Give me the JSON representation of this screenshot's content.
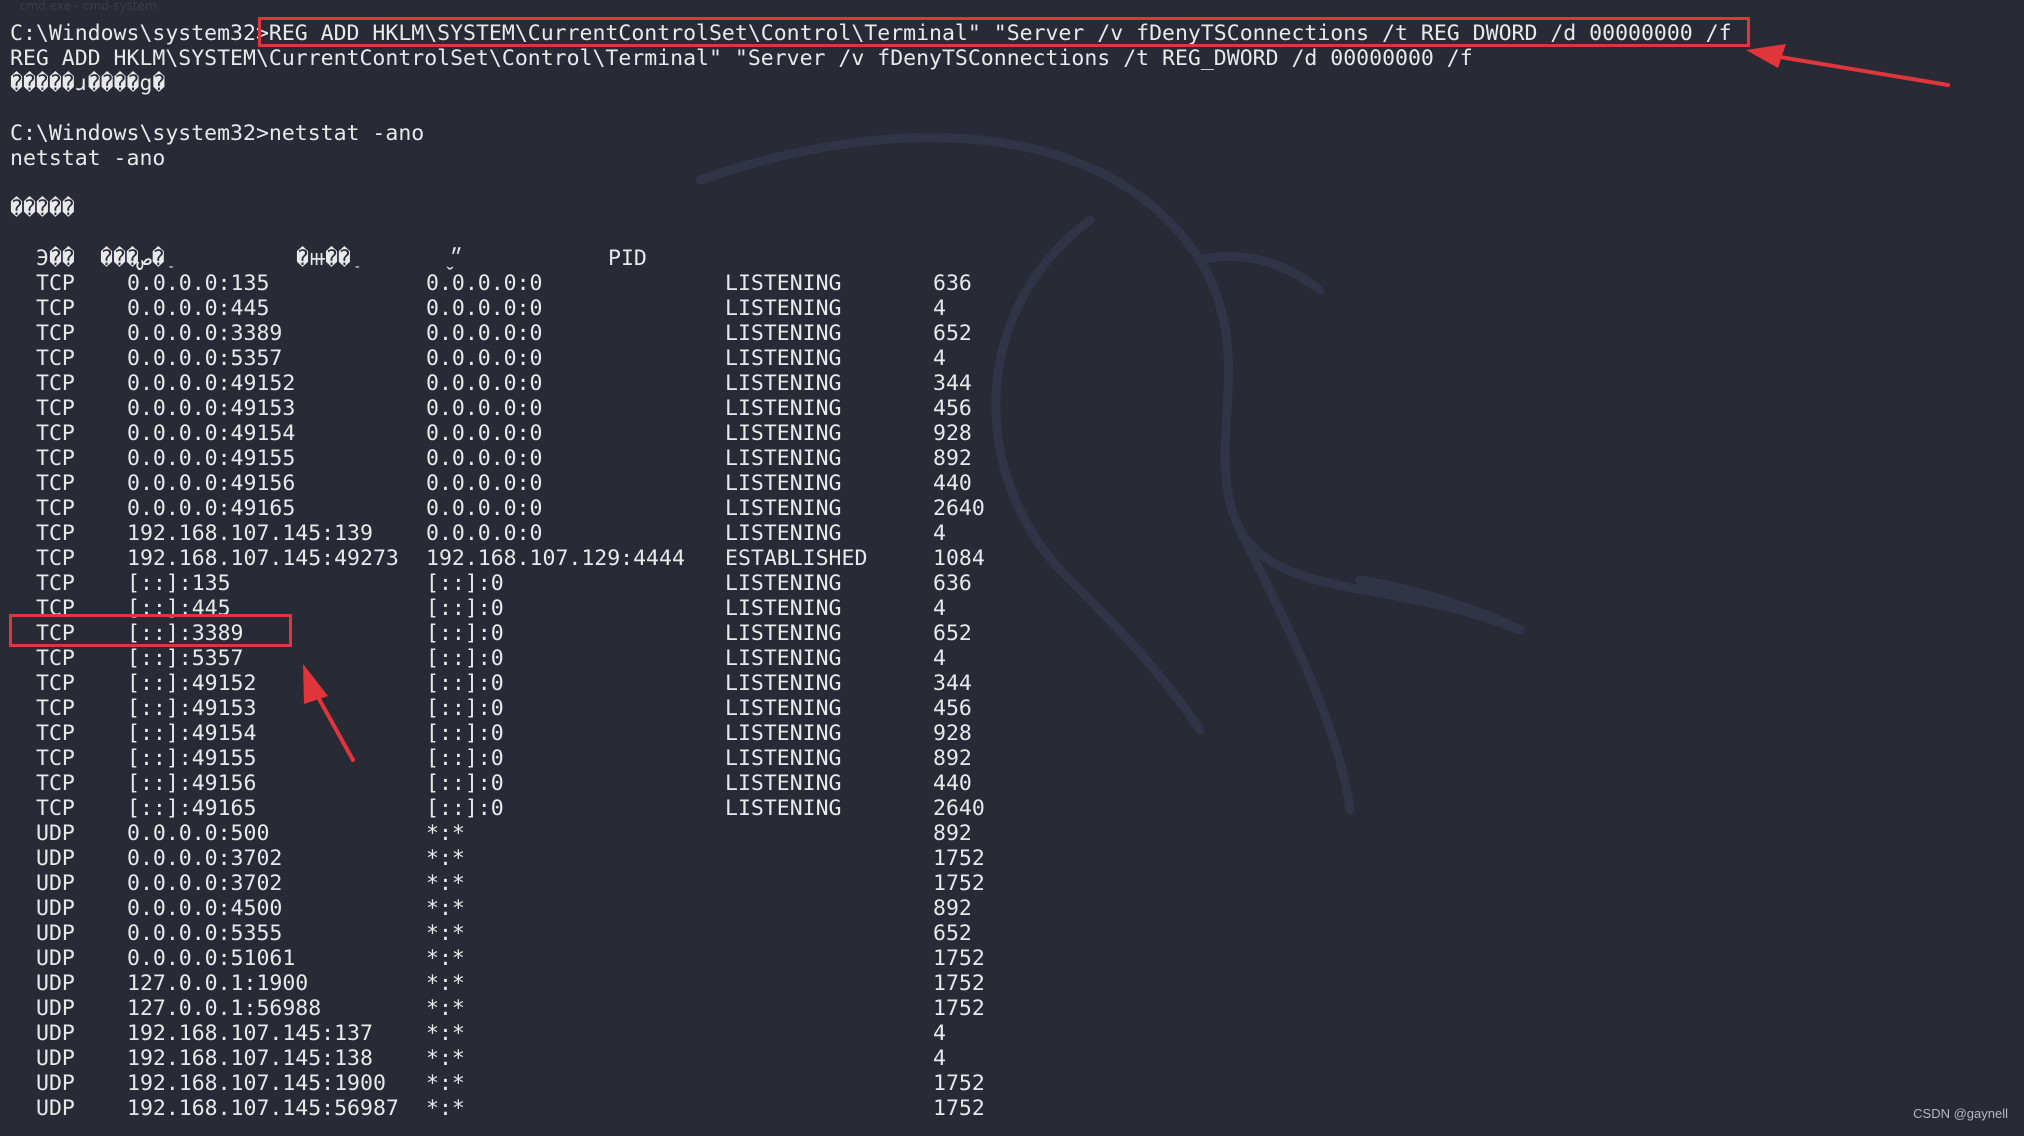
{
  "faint_header": "cmd.exe - cmd-system",
  "credit": "CSDN @gaynell",
  "colors": {
    "background": "#282a36",
    "text": "#e9e9ec",
    "highlight": "#e0353b"
  },
  "lines": [
    {
      "text": "C:\\Windows\\system32>REG ADD HKLM\\SYSTEM\\CurrentControlSet\\Control\\Terminal\" \"Server /v fDenyTSConnections /t REG_DWORD /d 00000000 /f"
    },
    {
      "text": "REG ADD HKLM\\SYSTEM\\CurrentControlSet\\Control\\Terminal\" \"Server /v fDenyTSConnections /t REG_DWORD /d 00000000 /f"
    },
    {
      "text": "�����ɹ����g�"
    },
    {
      "text": ""
    },
    {
      "text": "C:\\Windows\\system32>netstat -ano"
    },
    {
      "text": "netstat -ano"
    },
    {
      "text": ""
    },
    {
      "text": "�����"
    }
  ],
  "netstat": {
    "headers": [
      "Э��",
      "���ص�ַ",
      "�ⲿ��ַ",
      "״̬",
      "PID"
    ],
    "rows": [
      [
        "TCP",
        "0.0.0.0:135",
        "0.0.0.0:0",
        "LISTENING",
        "636"
      ],
      [
        "TCP",
        "0.0.0.0:445",
        "0.0.0.0:0",
        "LISTENING",
        "4"
      ],
      [
        "TCP",
        "0.0.0.0:3389",
        "0.0.0.0:0",
        "LISTENING",
        "652"
      ],
      [
        "TCP",
        "0.0.0.0:5357",
        "0.0.0.0:0",
        "LISTENING",
        "4"
      ],
      [
        "TCP",
        "0.0.0.0:49152",
        "0.0.0.0:0",
        "LISTENING",
        "344"
      ],
      [
        "TCP",
        "0.0.0.0:49153",
        "0.0.0.0:0",
        "LISTENING",
        "456"
      ],
      [
        "TCP",
        "0.0.0.0:49154",
        "0.0.0.0:0",
        "LISTENING",
        "928"
      ],
      [
        "TCP",
        "0.0.0.0:49155",
        "0.0.0.0:0",
        "LISTENING",
        "892"
      ],
      [
        "TCP",
        "0.0.0.0:49156",
        "0.0.0.0:0",
        "LISTENING",
        "440"
      ],
      [
        "TCP",
        "0.0.0.0:49165",
        "0.0.0.0:0",
        "LISTENING",
        "2640"
      ],
      [
        "TCP",
        "192.168.107.145:139",
        "0.0.0.0:0",
        "LISTENING",
        "4"
      ],
      [
        "TCP",
        "192.168.107.145:49273",
        "192.168.107.129:4444",
        "ESTABLISHED",
        "1084"
      ],
      [
        "TCP",
        "[::]:135",
        "[::]:0",
        "LISTENING",
        "636"
      ],
      [
        "TCP",
        "[::]:445",
        "[::]:0",
        "LISTENING",
        "4"
      ],
      [
        "TCP",
        "[::]:3389",
        "[::]:0",
        "LISTENING",
        "652"
      ],
      [
        "TCP",
        "[::]:5357",
        "[::]:0",
        "LISTENING",
        "4"
      ],
      [
        "TCP",
        "[::]:49152",
        "[::]:0",
        "LISTENING",
        "344"
      ],
      [
        "TCP",
        "[::]:49153",
        "[::]:0",
        "LISTENING",
        "456"
      ],
      [
        "TCP",
        "[::]:49154",
        "[::]:0",
        "LISTENING",
        "928"
      ],
      [
        "TCP",
        "[::]:49155",
        "[::]:0",
        "LISTENING",
        "892"
      ],
      [
        "TCP",
        "[::]:49156",
        "[::]:0",
        "LISTENING",
        "440"
      ],
      [
        "TCP",
        "[::]:49165",
        "[::]:0",
        "LISTENING",
        "2640"
      ],
      [
        "UDP",
        "0.0.0.0:500",
        "*:*",
        "",
        "892"
      ],
      [
        "UDP",
        "0.0.0.0:3702",
        "*:*",
        "",
        "1752"
      ],
      [
        "UDP",
        "0.0.0.0:3702",
        "*:*",
        "",
        "1752"
      ],
      [
        "UDP",
        "0.0.0.0:4500",
        "*:*",
        "",
        "892"
      ],
      [
        "UDP",
        "0.0.0.0:5355",
        "*:*",
        "",
        "652"
      ],
      [
        "UDP",
        "0.0.0.0:51061",
        "*:*",
        "",
        "1752"
      ],
      [
        "UDP",
        "127.0.0.1:1900",
        "*:*",
        "",
        "1752"
      ],
      [
        "UDP",
        "127.0.0.1:56988",
        "*:*",
        "",
        "1752"
      ],
      [
        "UDP",
        "192.168.107.145:137",
        "*:*",
        "",
        "4"
      ],
      [
        "UDP",
        "192.168.107.145:138",
        "*:*",
        "",
        "4"
      ],
      [
        "UDP",
        "192.168.107.145:1900",
        "*:*",
        "",
        "1752"
      ],
      [
        "UDP",
        "192.168.107.145:56987",
        "*:*",
        "",
        "1752"
      ]
    ]
  }
}
